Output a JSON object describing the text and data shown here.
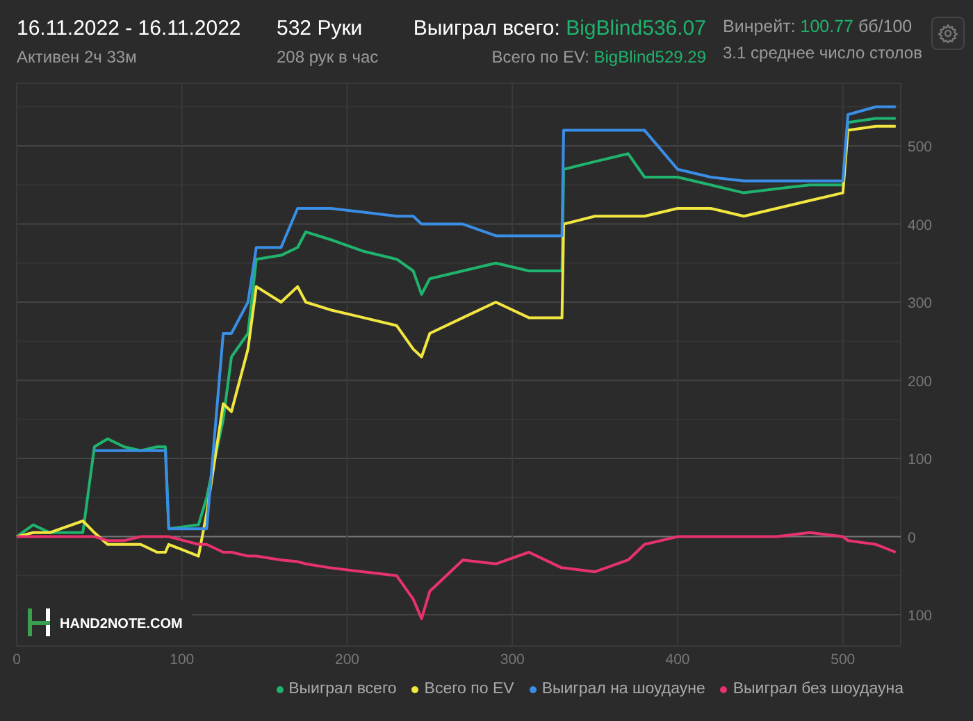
{
  "header": {
    "date_range": "16.11.2022 - 16.11.2022",
    "active_time": "Активен 2ч 33м",
    "hands": "532 Руки",
    "hands_per_hour": "208 рук в час",
    "won_total": {
      "label": "Выиграл всего:",
      "value": "BigBlind536.07"
    },
    "ev_total": {
      "label": "Всего по EV:",
      "value": "BigBlind529.29"
    },
    "winrate": {
      "label": "Винрейт:",
      "value": "100.77",
      "unit": "бб/100"
    },
    "avg_tables": "3.1 среднее число столов"
  },
  "logo": "HAND2NOTE.COM",
  "chart_data": {
    "type": "line",
    "grid": true,
    "xlim": [
      0,
      535
    ],
    "ylim": [
      -140,
      580
    ],
    "xticks": [
      0,
      100,
      200,
      300,
      400,
      500
    ],
    "yticks": [
      {
        "value": -100,
        "label": "100"
      },
      0,
      100,
      200,
      300,
      400,
      500
    ],
    "x": [
      0,
      10,
      20,
      40,
      47,
      55,
      65,
      75,
      85,
      90,
      92,
      110,
      115,
      125,
      130,
      140,
      145,
      160,
      170,
      175,
      190,
      210,
      230,
      240,
      245,
      250,
      270,
      290,
      310,
      330,
      331,
      350,
      370,
      380,
      400,
      420,
      440,
      460,
      480,
      500,
      503,
      520,
      532
    ],
    "series": [
      {
        "name": "Выиграл всего",
        "color": "#1fb36d",
        "values": [
          0,
          15,
          5,
          5,
          115,
          125,
          115,
          110,
          115,
          115,
          10,
          15,
          50,
          150,
          230,
          260,
          355,
          360,
          370,
          390,
          380,
          365,
          355,
          340,
          310,
          330,
          340,
          350,
          340,
          340,
          470,
          480,
          490,
          460,
          460,
          450,
          440,
          445,
          450,
          450,
          530,
          535,
          535
        ]
      },
      {
        "name": "Всего по EV",
        "color": "#f2e640",
        "values": [
          0,
          5,
          5,
          20,
          5,
          -10,
          -10,
          -10,
          -20,
          -20,
          -10,
          -25,
          30,
          170,
          160,
          240,
          320,
          300,
          320,
          300,
          290,
          280,
          270,
          240,
          230,
          260,
          280,
          300,
          280,
          280,
          400,
          410,
          410,
          410,
          420,
          420,
          410,
          420,
          430,
          440,
          520,
          525,
          525
        ]
      },
      {
        "name": "Выиграл на шоудауне",
        "color": "#3a8ee6",
        "values": [
          null,
          null,
          null,
          null,
          110,
          110,
          110,
          110,
          110,
          110,
          10,
          10,
          10,
          260,
          260,
          300,
          370,
          370,
          420,
          420,
          420,
          415,
          410,
          410,
          400,
          400,
          400,
          385,
          385,
          385,
          520,
          520,
          520,
          520,
          470,
          460,
          455,
          455,
          455,
          455,
          540,
          550,
          550
        ]
      },
      {
        "name": "Выиграл без шоудауна",
        "color": "#e6336c",
        "values": [
          0,
          0,
          0,
          0,
          0,
          -5,
          -5,
          0,
          0,
          0,
          0,
          -10,
          -10,
          -20,
          -20,
          -25,
          -25,
          -30,
          -32,
          -35,
          -40,
          -45,
          -50,
          -80,
          -105,
          -70,
          -30,
          -35,
          -20,
          -40,
          -40,
          -45,
          -30,
          -10,
          0,
          0,
          0,
          0,
          5,
          0,
          -5,
          -10,
          -20
        ]
      }
    ]
  }
}
